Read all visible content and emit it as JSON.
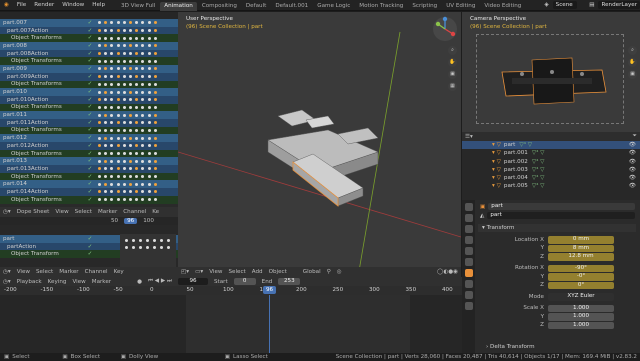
{
  "menu": [
    "File",
    "Render",
    "Window",
    "Help"
  ],
  "workspaces": [
    {
      "label": "3D View Full"
    },
    {
      "label": "Animation",
      "active": true
    },
    {
      "label": "Compositing"
    },
    {
      "label": "Default"
    },
    {
      "label": "Default.001"
    },
    {
      "label": "Game Logic"
    },
    {
      "label": "Motion Tracking"
    },
    {
      "label": "Scripting"
    },
    {
      "label": "UV Editing"
    },
    {
      "label": "Video Editing"
    }
  ],
  "scene": "Scene",
  "render_layer": "RenderLayer",
  "dopesheet": {
    "channels": [
      {
        "k": "obj",
        "label": "part.007"
      },
      {
        "k": "act",
        "label": "part.007Action"
      },
      {
        "k": "ot",
        "label": "Object Transforms"
      },
      {
        "k": "obj",
        "label": "part.008"
      },
      {
        "k": "act",
        "label": "part.008Action"
      },
      {
        "k": "ot",
        "label": "Object Transforms"
      },
      {
        "k": "obj",
        "label": "part.009"
      },
      {
        "k": "act",
        "label": "part.009Action"
      },
      {
        "k": "ot",
        "label": "Object Transforms"
      },
      {
        "k": "obj",
        "label": "part.010"
      },
      {
        "k": "act",
        "label": "part.010Action"
      },
      {
        "k": "ot",
        "label": "Object Transforms"
      },
      {
        "k": "obj",
        "label": "part.011"
      },
      {
        "k": "act",
        "label": "part.011Action"
      },
      {
        "k": "ot",
        "label": "Object Transforms"
      },
      {
        "k": "obj",
        "label": "part.012"
      },
      {
        "k": "act",
        "label": "part.012Action"
      },
      {
        "k": "ot",
        "label": "Object Transforms"
      },
      {
        "k": "obj",
        "label": "part.013"
      },
      {
        "k": "act",
        "label": "part.013Action"
      },
      {
        "k": "ot",
        "label": "Object Transforms"
      },
      {
        "k": "obj",
        "label": "part.014"
      },
      {
        "k": "act",
        "label": "part.014Action"
      },
      {
        "k": "ot",
        "label": "Object Transforms"
      }
    ],
    "header": [
      "Dope Sheet",
      "View",
      "Select",
      "Marker",
      "Channel",
      "Ke"
    ],
    "ruler": [
      "50",
      "96",
      "100"
    ]
  },
  "lower_ds": {
    "channels": [
      {
        "k": "obj",
        "label": "part"
      },
      {
        "k": "act",
        "label": "partAction"
      },
      {
        "k": "ot",
        "label": "Object Transform"
      }
    ],
    "header": [
      "View",
      "Select",
      "Marker",
      "Channel",
      "Key"
    ],
    "normalize": "Normalize"
  },
  "viewport": {
    "title": "User Perspective",
    "subtitle": "(96) Scene Collection | part",
    "header": [
      "View",
      "Select",
      "Add",
      "Object"
    ],
    "orientation": "Global"
  },
  "camera": {
    "title": "Camera Perspective",
    "subtitle": "(96) Scene Collection | part"
  },
  "outliner": {
    "rows": [
      {
        "label": "part",
        "sel": true
      },
      {
        "label": "part.001"
      },
      {
        "label": "part.002"
      },
      {
        "label": "part.003"
      },
      {
        "label": "part.004"
      },
      {
        "label": "part.005"
      }
    ]
  },
  "props": {
    "object": "part",
    "data": "part",
    "transform": "Transform",
    "location": {
      "label": "Location X",
      "x": "0 mm",
      "y": "8 mm",
      "z": "12.8 mm"
    },
    "rotation": {
      "label": "Rotation X",
      "x": "-90°",
      "y": "-0°",
      "z": "0°"
    },
    "mode_label": "Mode",
    "mode": "XYZ Euler",
    "scale": {
      "label": "Scale X",
      "x": "1.000",
      "y": "1.000",
      "z": "1.000"
    },
    "delta": "Delta Transform",
    "Y": "Y",
    "Z": "Z"
  },
  "timeline": {
    "header": [
      "Playback",
      "Keying",
      "View",
      "Marker"
    ],
    "current": "96",
    "start_label": "Start",
    "start": "0",
    "end_label": "End",
    "end": "253",
    "ticks": [
      "-200",
      "-150",
      "-100",
      "-50",
      "0",
      "50",
      "100",
      "150",
      "200",
      "250",
      "300",
      "350",
      "400"
    ]
  },
  "status": {
    "select": "Select",
    "box": "Box Select",
    "dolly": "Dolly View",
    "lasso": "Lasso Select",
    "info": "Scene Collection | part | Verts 28,060 | Faces 20,487 | Tris 40,614 | Objects 1/17 | Mem: 169.4 MiB | v2.83.2"
  }
}
